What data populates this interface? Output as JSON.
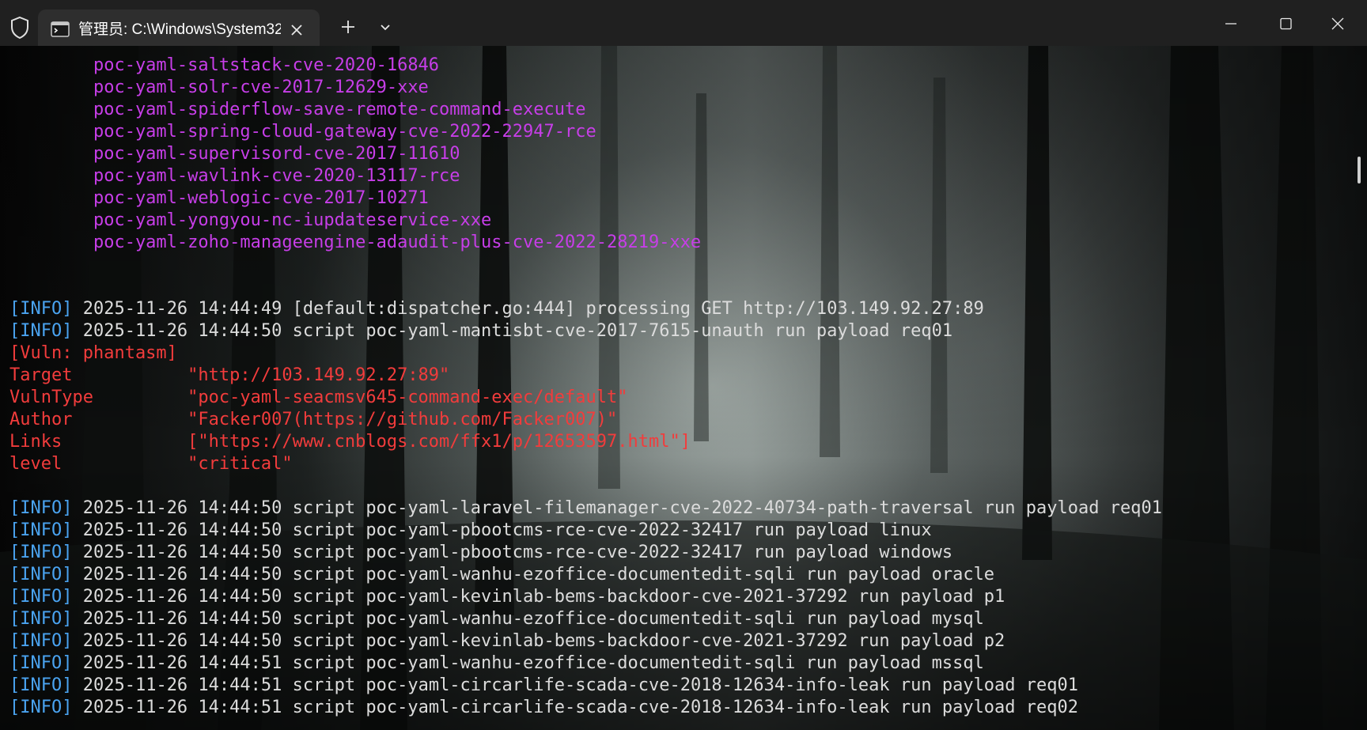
{
  "window": {
    "tab_title": "管理员: C:\\Windows\\System32",
    "icons": {
      "shield": "shield-icon",
      "terminal": "terminal-icon",
      "close_tab": "close-icon",
      "new_tab": "plus-icon",
      "dropdown": "chevron-down-icon",
      "minimize": "minimize-icon",
      "maximize": "maximize-icon",
      "close": "close-icon"
    }
  },
  "colors": {
    "poc": "#c73ee8",
    "info": "#4aa3f0",
    "vuln": "#f23c3c",
    "text": "#dcdcdc"
  },
  "terminal": {
    "poc_list": [
      "        poc-yaml-saltstack-cve-2020-16846",
      "        poc-yaml-solr-cve-2017-12629-xxe",
      "        poc-yaml-spiderflow-save-remote-command-execute",
      "        poc-yaml-spring-cloud-gateway-cve-2022-22947-rce",
      "        poc-yaml-supervisord-cve-2017-11610",
      "        poc-yaml-wavlink-cve-2020-13117-rce",
      "        poc-yaml-weblogic-cve-2017-10271",
      "        poc-yaml-yongyou-nc-iupdateservice-xxe",
      "        poc-yaml-zoho-manageengine-adaudit-plus-cve-2022-28219-xxe"
    ],
    "info_tag": "[INFO]",
    "log_before": [
      " 2025-11-26 14:44:49 [default:dispatcher.go:444] processing GET http://103.149.92.27:89",
      " 2025-11-26 14:44:50 script poc-yaml-mantisbt-cve-2017-7615-unauth run payload req01"
    ],
    "vuln_block": [
      "[Vuln: phantasm]",
      "Target           \"http://103.149.92.27:89\"",
      "VulnType         \"poc-yaml-seacmsv645-command-exec/default\"",
      "Author           \"Facker007(https://github.com/Facker007)\"",
      "Links            [\"https://www.cnblogs.com/ffx1/p/12653597.html\"]",
      "level            \"critical\""
    ],
    "log_after": [
      " 2025-11-26 14:44:50 script poc-yaml-laravel-filemanager-cve-2022-40734-path-traversal run payload req01",
      " 2025-11-26 14:44:50 script poc-yaml-pbootcms-rce-cve-2022-32417 run payload linux",
      " 2025-11-26 14:44:50 script poc-yaml-pbootcms-rce-cve-2022-32417 run payload windows",
      " 2025-11-26 14:44:50 script poc-yaml-wanhu-ezoffice-documentedit-sqli run payload oracle",
      " 2025-11-26 14:44:50 script poc-yaml-kevinlab-bems-backdoor-cve-2021-37292 run payload p1",
      " 2025-11-26 14:44:50 script poc-yaml-wanhu-ezoffice-documentedit-sqli run payload mysql",
      " 2025-11-26 14:44:50 script poc-yaml-kevinlab-bems-backdoor-cve-2021-37292 run payload p2",
      " 2025-11-26 14:44:51 script poc-yaml-wanhu-ezoffice-documentedit-sqli run payload mssql",
      " 2025-11-26 14:44:51 script poc-yaml-circarlife-scada-cve-2018-12634-info-leak run payload req01",
      " 2025-11-26 14:44:51 script poc-yaml-circarlife-scada-cve-2018-12634-info-leak run payload req02"
    ]
  }
}
